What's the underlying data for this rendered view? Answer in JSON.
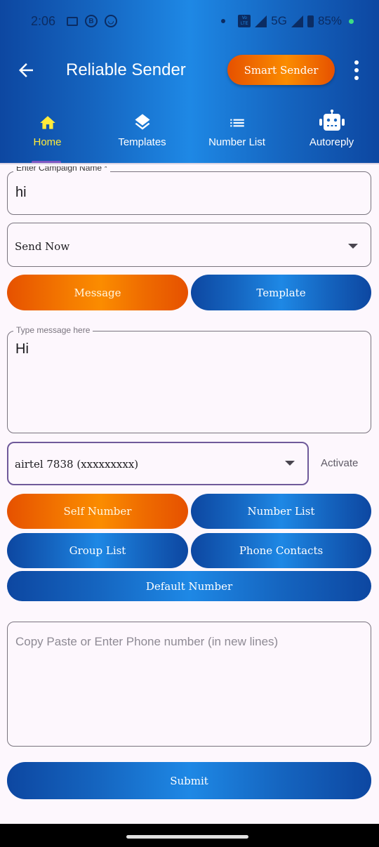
{
  "status_bar": {
    "time": "2:06",
    "left_icons": [
      "video-call-icon",
      "b-circle-icon",
      "face-icon"
    ],
    "network": "5G",
    "volte_label": "Vo LTE",
    "battery": "85%"
  },
  "app_bar": {
    "back_icon": "arrow-left-icon",
    "title": "Reliable Sender",
    "smart_sender_label": "Smart Sender",
    "more_icon": "more-vert-icon"
  },
  "tabs": [
    {
      "label": "Home",
      "icon": "home-icon",
      "active": true
    },
    {
      "label": "Templates",
      "icon": "layers-icon",
      "active": false
    },
    {
      "label": "Number List",
      "icon": "list-icon",
      "active": false
    },
    {
      "label": "Autoreply",
      "icon": "robot-icon",
      "active": false
    }
  ],
  "form": {
    "campaign_label": "Enter Campaign Name *",
    "campaign_value": "hi",
    "schedule_value": "Send Now",
    "mode_buttons": {
      "message": "Message",
      "template": "Template"
    },
    "message_label": "Type message here",
    "message_value": "Hi",
    "sim_value": "airtel 7838 (xxxxxxxxx)",
    "activate_label": "Activate",
    "source_buttons": {
      "self_number": "Self Number",
      "number_list": "Number List",
      "group_list": "Group List",
      "phone_contacts": "Phone Contacts",
      "default_number": "Default Number"
    },
    "phones_placeholder": "Copy Paste or Enter Phone number (in new lines)",
    "phones_value": "",
    "submit_label": "Submit"
  },
  "colors": {
    "primary_blue": "#1565c0",
    "accent_orange": "#f57c00",
    "active_tab": "#ffeb3b",
    "background": "#fdf7fd"
  }
}
